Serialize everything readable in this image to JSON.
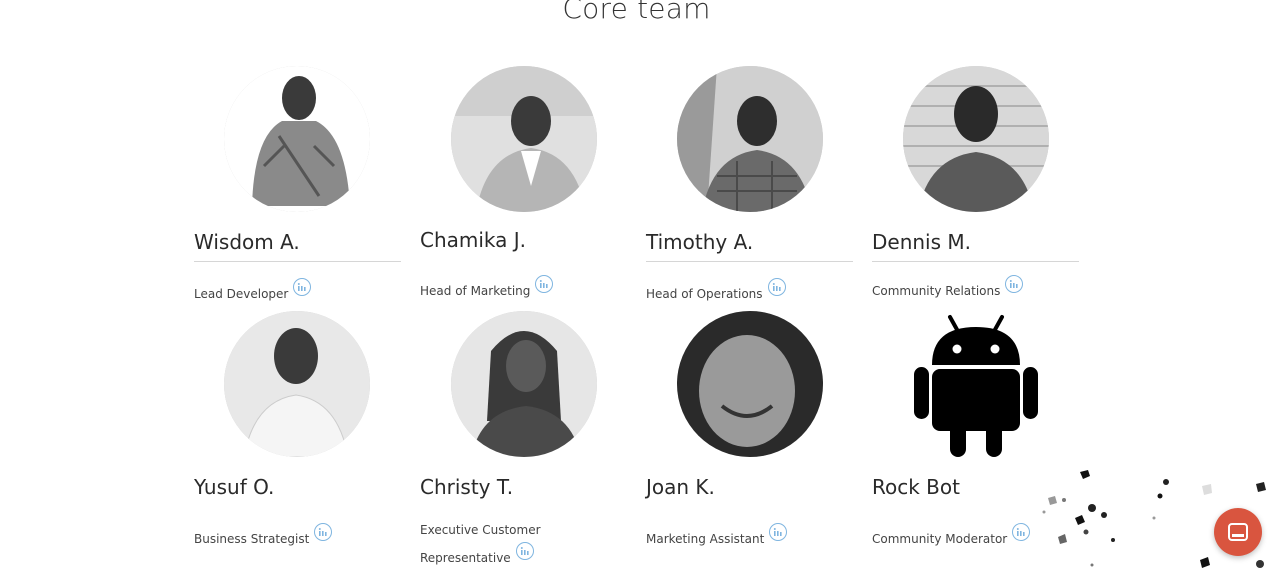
{
  "title": "Core team",
  "members": [
    {
      "name": "Wisdom A.",
      "role": "Lead Developer"
    },
    {
      "name": "Chamika J.",
      "role": "Head of Marketing"
    },
    {
      "name": "Timothy A.",
      "role": "Head of Operations"
    },
    {
      "name": "Dennis M.",
      "role": "Community Relations"
    },
    {
      "name": "Yusuf O.",
      "role": "Business Strategist"
    },
    {
      "name": "Christy T.",
      "role_line1": "Executive Customer",
      "role_line2": "Representative"
    },
    {
      "name": "Joan K.",
      "role": "Marketing Assistant"
    },
    {
      "name": "Rock Bot",
      "role": "Community Moderator"
    }
  ],
  "icons": {
    "social": "linkedin-icon",
    "chat": "chat-icon",
    "bot_avatar": "android-icon"
  },
  "colors": {
    "social_icon": "#7fb5e0",
    "chat_button": "#d9553f"
  }
}
